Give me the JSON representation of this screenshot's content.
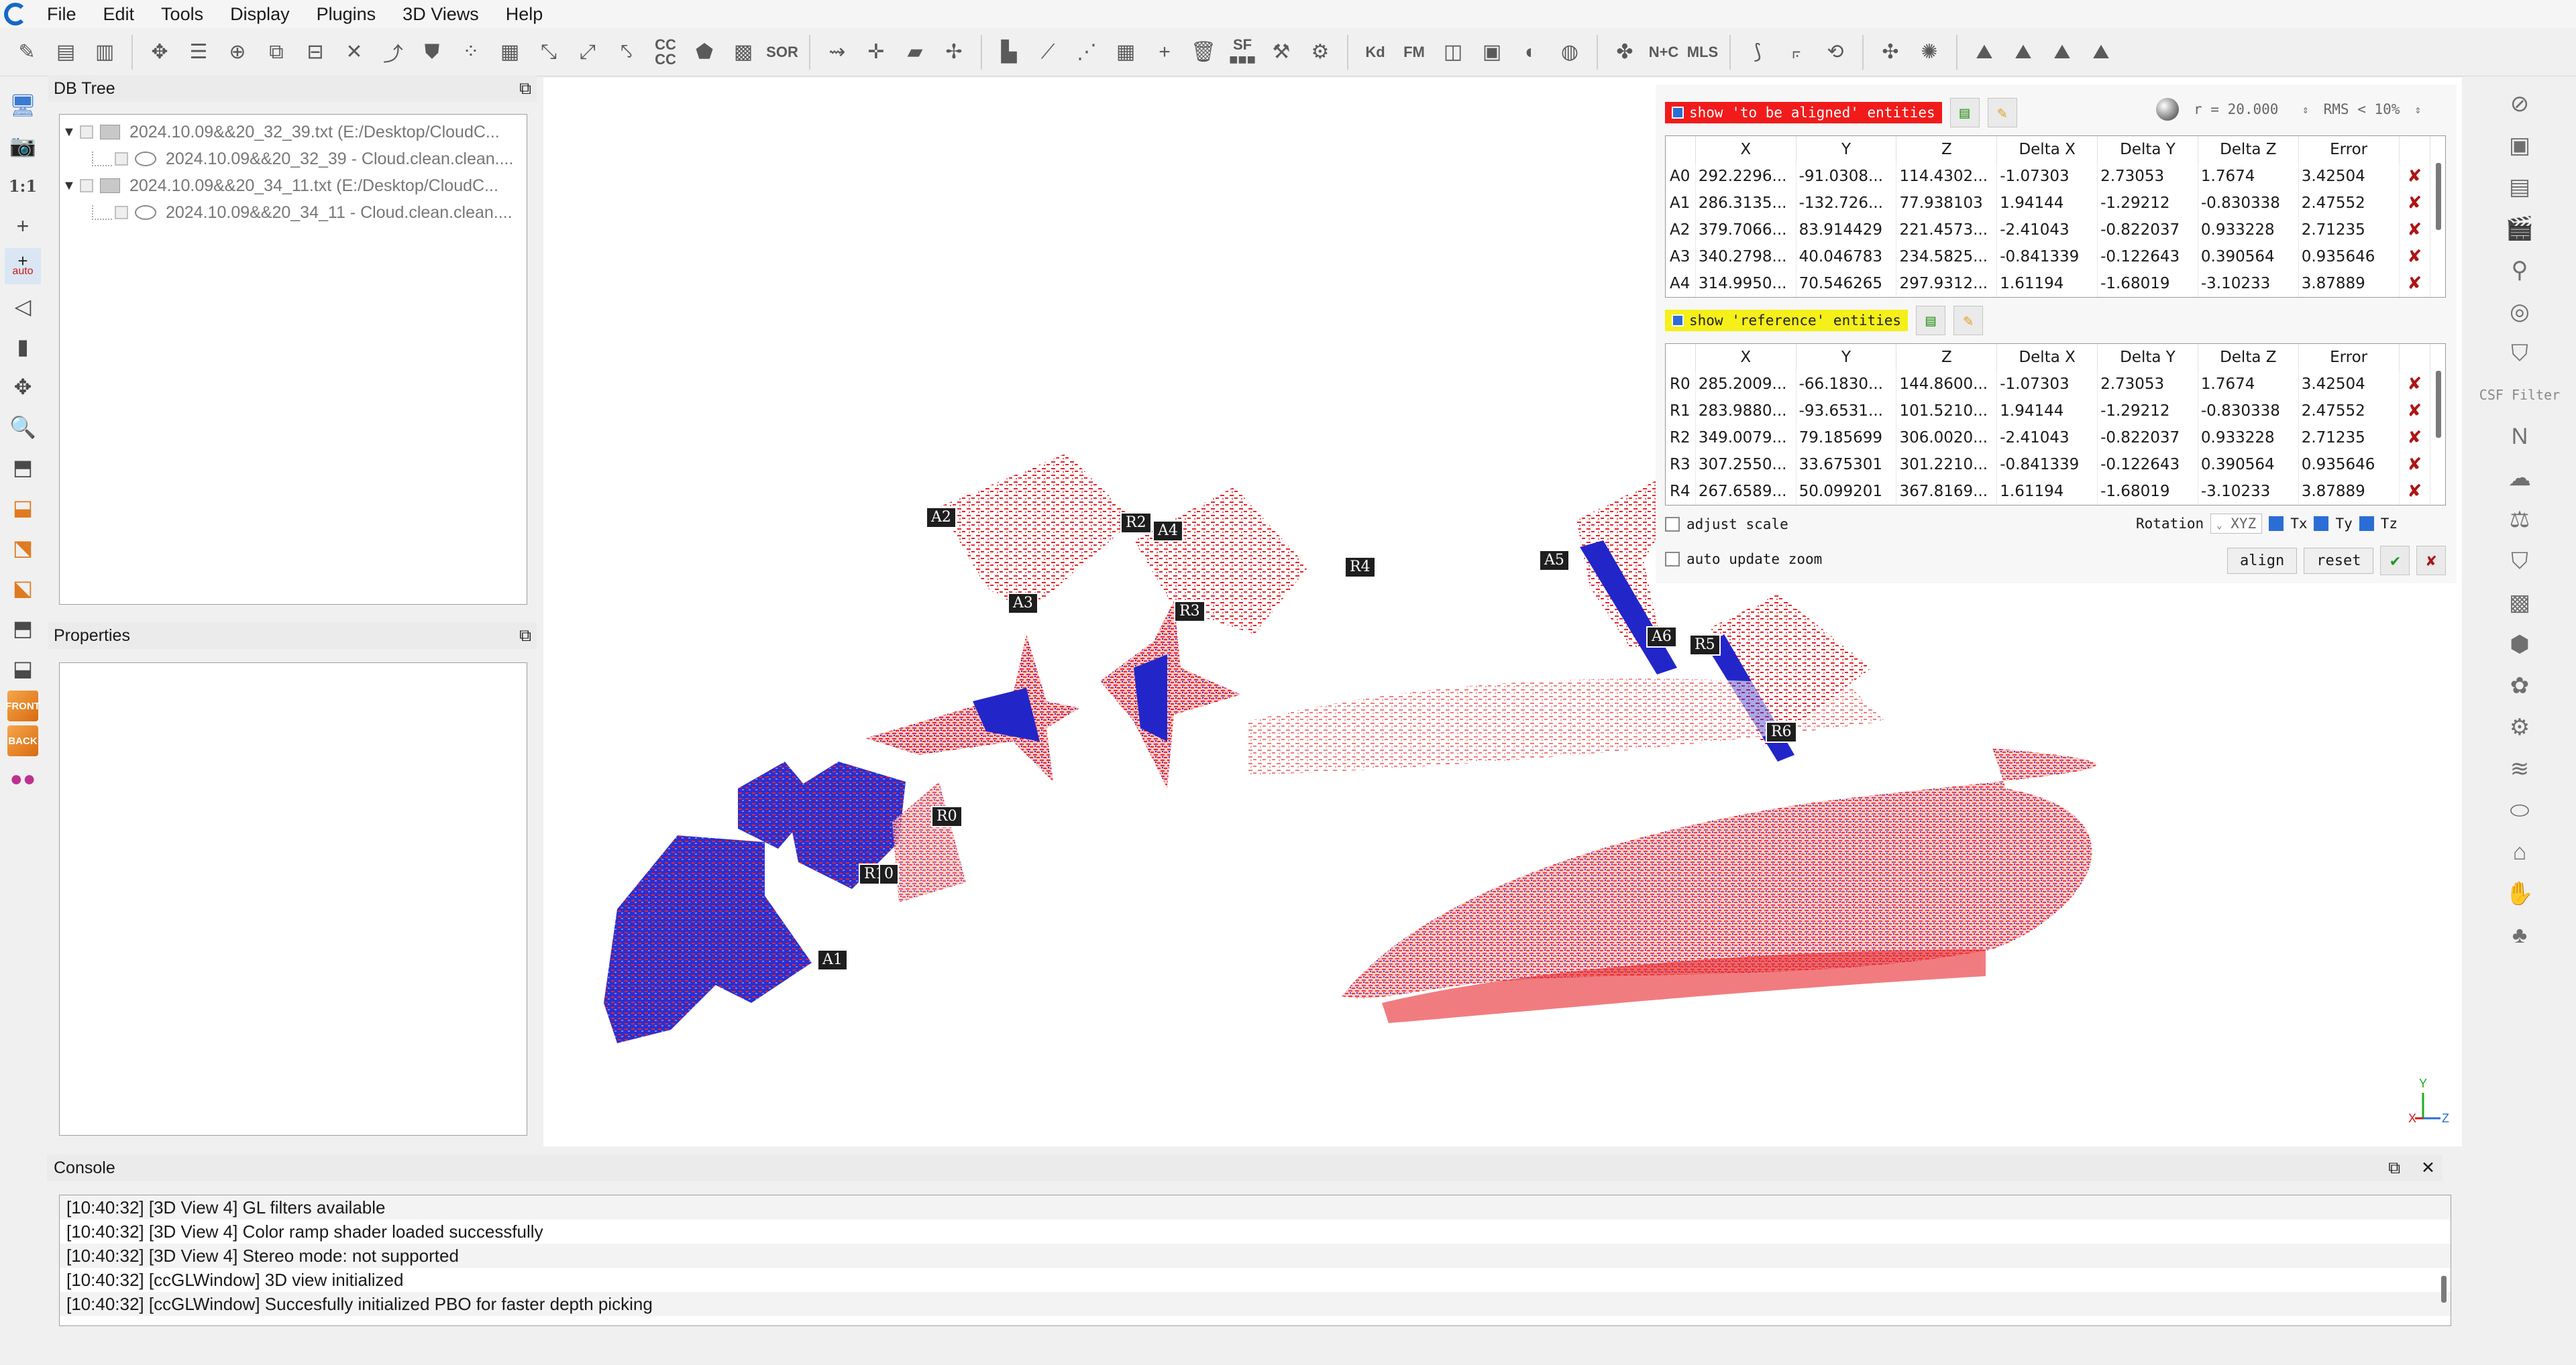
{
  "menubar": {
    "items": [
      "File",
      "Edit",
      "Tools",
      "Display",
      "Plugins",
      "3D Views",
      "Help"
    ]
  },
  "toolbar": {
    "text_buttons": [
      "CC\nCC",
      "SOR",
      "SF\n■■■",
      "Kd",
      "FM",
      "N+C",
      "MLS"
    ]
  },
  "lefttools": {
    "scale_label": "1:1",
    "auto_label": "auto",
    "front_label": "FRONT",
    "back_label": "BACK"
  },
  "dbtree": {
    "title": "DB Tree",
    "items": [
      {
        "label": "2024.10.09&&20_32_39.txt (E:/Desktop/CloudC...",
        "level": 0
      },
      {
        "label": "2024.10.09&&20_32_39 - Cloud.clean.clean....",
        "level": 1
      },
      {
        "label": "2024.10.09&&20_34_11.txt (E:/Desktop/CloudC...",
        "level": 0
      },
      {
        "label": "2024.10.09&&20_34_11 - Cloud.clean.clean....",
        "level": 1
      }
    ]
  },
  "properties": {
    "title": "Properties"
  },
  "align": {
    "aligned_label": "show 'to be aligned' entities",
    "reference_label": "show 'reference' entities",
    "radius_label": "r = 20.000",
    "rms_label": "RMS < 10%",
    "columns": [
      "X",
      "Y",
      "Z",
      "Delta X",
      "Delta Y",
      "Delta Z",
      "Error"
    ],
    "aligned_rows": [
      {
        "id": "A0",
        "x": "292.2296...",
        "y": "-91.0308...",
        "z": "114.4302...",
        "dx": "-1.07303",
        "dy": "2.73053",
        "dz": "1.7674",
        "err": "3.42504"
      },
      {
        "id": "A1",
        "x": "286.3135...",
        "y": "-132.726...",
        "z": "77.938103",
        "dx": "1.94144",
        "dy": "-1.29212",
        "dz": "-0.830338",
        "err": "2.47552"
      },
      {
        "id": "A2",
        "x": "379.7066...",
        "y": "83.914429",
        "z": "221.4573...",
        "dx": "-2.41043",
        "dy": "-0.822037",
        "dz": "0.933228",
        "err": "2.71235"
      },
      {
        "id": "A3",
        "x": "340.2798...",
        "y": "40.046783",
        "z": "234.5825...",
        "dx": "-0.841339",
        "dy": "-0.122643",
        "dz": "0.390564",
        "err": "0.935646"
      },
      {
        "id": "A4",
        "x": "314.9950...",
        "y": "70.546265",
        "z": "297.9312...",
        "dx": "1.61194",
        "dy": "-1.68019",
        "dz": "-3.10233",
        "err": "3.87889"
      }
    ],
    "reference_rows": [
      {
        "id": "R0",
        "x": "285.2009...",
        "y": "-66.1830...",
        "z": "144.8600...",
        "dx": "-1.07303",
        "dy": "2.73053",
        "dz": "1.7674",
        "err": "3.42504"
      },
      {
        "id": "R1",
        "x": "283.9880...",
        "y": "-93.6531...",
        "z": "101.5210...",
        "dx": "1.94144",
        "dy": "-1.29212",
        "dz": "-0.830338",
        "err": "2.47552"
      },
      {
        "id": "R2",
        "x": "349.0079...",
        "y": "79.185699",
        "z": "306.0020...",
        "dx": "-2.41043",
        "dy": "-0.822037",
        "dz": "0.933228",
        "err": "2.71235"
      },
      {
        "id": "R3",
        "x": "307.2550...",
        "y": "33.675301",
        "z": "301.2210...",
        "dx": "-0.841339",
        "dy": "-0.122643",
        "dz": "0.390564",
        "err": "0.935646"
      },
      {
        "id": "R4",
        "x": "267.6589...",
        "y": "50.099201",
        "z": "367.8169...",
        "dx": "1.61194",
        "dy": "-1.68019",
        "dz": "-3.10233",
        "err": "3.87889"
      }
    ],
    "adjust_scale_label": "adjust scale",
    "auto_zoom_label": "auto update zoom",
    "rotation_label": "Rotation",
    "rotation_value": "XYZ",
    "tx_label": "Tx",
    "ty_label": "Ty",
    "tz_label": "Tz",
    "align_button": "align",
    "reset_button": "reset",
    "delete_glyph": "✘"
  },
  "view3d": {
    "point_labels": [
      "A2",
      "R2",
      "A4",
      "R4",
      "A3",
      "R3",
      "A5",
      "A6",
      "R5",
      "R6",
      "R0",
      "R1",
      "0",
      "A1"
    ],
    "axes": {
      "x": "X",
      "y": "Y",
      "z": "Z"
    }
  },
  "righttools": {
    "csf_label": "CSF Filter"
  },
  "console": {
    "title": "Console",
    "lines": [
      "[10:40:32] [3D View 4] GL filters available",
      "[10:40:32] [3D View 4] Color ramp shader loaded successfully",
      "[10:40:32] [3D View 4] Stereo mode: not supported",
      "[10:40:32] [ccGLWindow] 3D view initialized",
      "[10:40:32] [ccGLWindow] Succesfully initialized PBO for faster depth picking"
    ]
  },
  "colors": {
    "cloud_red": "#e8242a",
    "cloud_blue": "#2226c9",
    "aligned_chip": "#f21b1b",
    "reference_chip": "#f5ef1a"
  }
}
